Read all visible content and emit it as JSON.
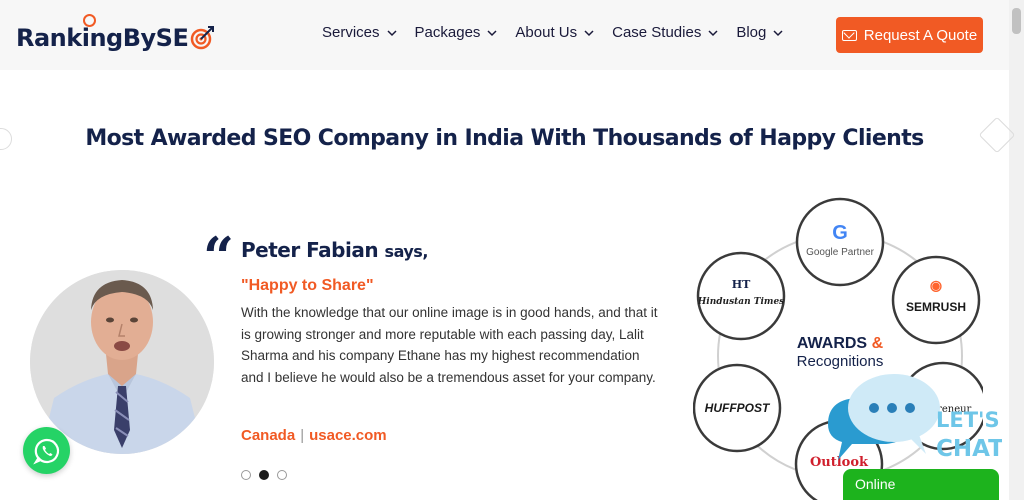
{
  "header": {
    "logo_pre": "Rank",
    "logo_i": "i",
    "logo_post": "ngBySE",
    "nav": [
      "Services",
      "Packages",
      "About Us",
      "Case Studies",
      "Blog"
    ],
    "cta_label": "Request A Quote"
  },
  "colors": {
    "accent": "#f15a24",
    "navy": "#14224a",
    "whatsapp": "#25d366",
    "online": "#1db31d",
    "chat_blue": "#6ec6e8"
  },
  "section": {
    "heading": "Most Awarded SEO Company in India With Thousands of Happy Clients"
  },
  "testimonial": {
    "name": "Peter Fabian",
    "says": "says,",
    "tagline": "\"Happy to Share\"",
    "body": "With the knowledge that our online image is in good hands, and that it is growing stronger and more reputable with each passing day, Lalit Sharma and his company Ethane has my highest recommendation and I believe he would also be a tremendous asset for your company.",
    "country": "Canada",
    "site": "usace.com",
    "active_slide": 2,
    "total_slides": 3
  },
  "awards": {
    "center_title": "AWARDS",
    "center_amp": "&",
    "center_sub": "Recognitions",
    "google": "Google Partner",
    "semrush": "SEMRUSH",
    "hindustan": "Hindustan Times",
    "huffpost": "HUFFPOST",
    "entrepreneur": "preneur",
    "outlook": "Outlook"
  },
  "chat": {
    "line1": "LET'S",
    "line2": "CHAT",
    "status": "Online"
  }
}
